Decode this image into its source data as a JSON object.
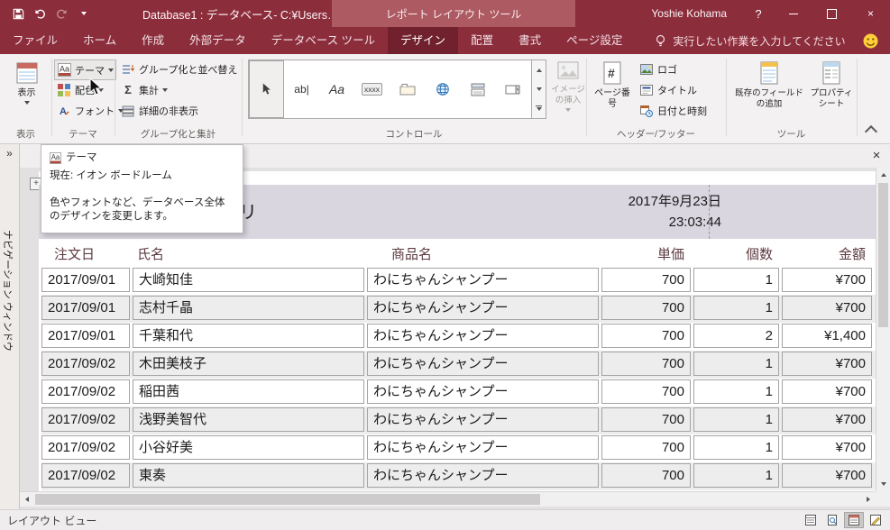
{
  "colors": {
    "titlebar": "#8C2D3C",
    "tab_selected": "#71202D",
    "contextual_band": "#AD5A62",
    "report_band": "#D9D6DF",
    "row_alt": "#EDEDED"
  },
  "titlebar": {
    "title": "Database1 : データベース- C:¥Users…",
    "contextual": "レポート レイアウト ツール",
    "user": "Yoshie Kohama",
    "help": "?"
  },
  "tabs": [
    {
      "label": "ファイル"
    },
    {
      "label": "ホーム"
    },
    {
      "label": "作成"
    },
    {
      "label": "外部データ"
    },
    {
      "label": "データベース ツール"
    },
    {
      "label": "デザイン"
    },
    {
      "label": "配置"
    },
    {
      "label": "書式"
    },
    {
      "label": "ページ設定"
    }
  ],
  "tellme": {
    "label": "実行したい作業を入力してください"
  },
  "ribbon": {
    "groups": {
      "view": "表示",
      "themes": "テーマ",
      "grouping": "グループ化と集計",
      "controls": "コントロール",
      "header_footer": "ヘッダー/フッター",
      "tools": "ツール"
    },
    "view": {
      "label": "表示"
    },
    "themes": {
      "theme": "テーマ",
      "colors": "配色",
      "fonts": "フォント"
    },
    "grouping": {
      "group_sort": "グループ化と並べ替え",
      "totals": "集計",
      "hide_details": "詳細の非表示"
    },
    "controls": {
      "glyph_textbox": "ab|",
      "glyph_label": "Aa",
      "glyph_button": "xxxx",
      "insert_image": "イメージ\nの挿入"
    },
    "header_footer": {
      "page_number": "ページ番号",
      "logo": "ロゴ",
      "title": "タイトル",
      "datetime": "日付と時刻"
    },
    "tools": {
      "add_fields": "既存のフィールド\nの追加",
      "property_sheet": "プロパティ\nシート"
    }
  },
  "tooltip": {
    "title": "テーマ",
    "current": "現在: イオン ボードルーム",
    "description": "色やフォントなど、データベース全体のデザインを変更します。"
  },
  "nav_pane": {
    "expand": "»",
    "label": "ナビゲーション ウィンドウ"
  },
  "report": {
    "title": "クエリ",
    "date": "2017年9月23日",
    "time": "23:03:44",
    "columns": [
      "注文日",
      "氏名",
      "商品名",
      "単価",
      "個数",
      "金額"
    ],
    "rows": [
      [
        "2017/09/01",
        "大崎知佳",
        "わにちゃんシャンプー",
        "700",
        "1",
        "¥700"
      ],
      [
        "2017/09/01",
        "志村千晶",
        "わにちゃんシャンプー",
        "700",
        "1",
        "¥700"
      ],
      [
        "2017/09/01",
        "千葉和代",
        "わにちゃんシャンプー",
        "700",
        "2",
        "¥1,400"
      ],
      [
        "2017/09/02",
        "木田美枝子",
        "わにちゃんシャンプー",
        "700",
        "1",
        "¥700"
      ],
      [
        "2017/09/02",
        "稲田茜",
        "わにちゃんシャンプー",
        "700",
        "1",
        "¥700"
      ],
      [
        "2017/09/02",
        "浅野美智代",
        "わにちゃんシャンプー",
        "700",
        "1",
        "¥700"
      ],
      [
        "2017/09/02",
        "小谷好美",
        "わにちゃんシャンプー",
        "700",
        "1",
        "¥700"
      ],
      [
        "2017/09/02",
        "東奏",
        "わにちゃんシャンプー",
        "700",
        "1",
        "¥700"
      ]
    ]
  },
  "statusbar": {
    "view_label": "レイアウト ビュー"
  }
}
